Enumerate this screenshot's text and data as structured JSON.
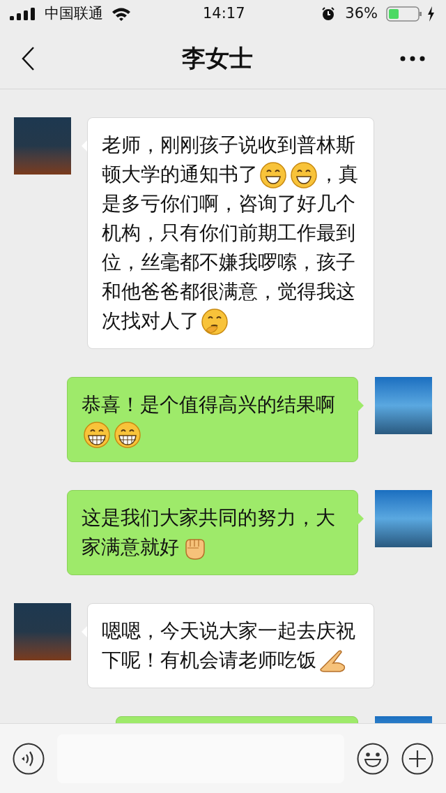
{
  "status_bar": {
    "carrier": "中国联通",
    "time": "14:17",
    "battery": "36%"
  },
  "nav": {
    "title": "李女士"
  },
  "messages": [
    {
      "kind": "received",
      "parts": [
        {
          "kind": "text",
          "text": "老师，刚刚孩子说收到普林斯顿大学的通知书了"
        },
        {
          "kind": "grin"
        },
        {
          "kind": "grin"
        },
        {
          "kind": "text",
          "text": "，真是多亏你们啊，咨询了好几个机构，只有你们前期工作最到位，丝毫都不嫌我啰嗦，孩子和他爸爸都很满意，觉得我这次找对人了"
        },
        {
          "kind": "think"
        }
      ]
    },
    {
      "kind": "sent",
      "parts": [
        {
          "kind": "text",
          "text": "恭喜！是个值得高兴的结果啊"
        },
        {
          "kind": "laugh"
        },
        {
          "kind": "laugh"
        }
      ]
    },
    {
      "kind": "sent",
      "parts": [
        {
          "kind": "text",
          "text": "这是我们大家共同的努力，大家满意就好"
        },
        {
          "kind": "fist"
        }
      ]
    },
    {
      "kind": "received",
      "parts": [
        {
          "kind": "text",
          "text": "嗯嗯，今天说大家一起去庆祝下呢！有机会请老师吃饭"
        },
        {
          "kind": "point"
        }
      ]
    },
    {
      "kind": "sent"
    }
  ]
}
